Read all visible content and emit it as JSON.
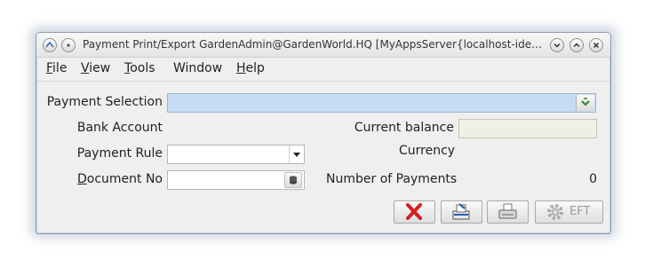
{
  "window": {
    "title": "Payment Print/Export  GardenAdmin@GardenWorld.HQ [MyAppsServer{localhost-idempiere-..."
  },
  "menu": [
    {
      "label": "File",
      "mnemonic": "F",
      "rest": "ile"
    },
    {
      "label": "View",
      "mnemonic": "V",
      "rest": "iew"
    },
    {
      "label": "Tools",
      "mnemonic": "T",
      "rest": "ools"
    },
    {
      "label": "Window",
      "mnemonic": "",
      "rest": "Window"
    },
    {
      "label": "Help",
      "mnemonic": "H",
      "rest": "elp"
    }
  ],
  "form": {
    "payment_selection_label": "Payment Selection",
    "payment_selection_value": "",
    "bank_account_label": "Bank Account",
    "bank_account_value": "",
    "current_balance_label": "Current balance",
    "current_balance_value": "",
    "payment_rule_label": "Payment Rule",
    "payment_rule_value": "",
    "currency_label": "Currency",
    "currency_value": "",
    "document_no_label_mnemonic": "D",
    "document_no_label_rest": "ocument No",
    "document_no_value": "",
    "number_of_payments_label": "Number of Payments",
    "number_of_payments_value": "0"
  },
  "buttons": {
    "eft_label": "EFT"
  },
  "colors": {
    "selection_field_bg": "#c6dcf4",
    "balance_field_bg": "#efefe6",
    "cancel_red": "#d42020"
  },
  "icons": [
    "app-icon",
    "shade-icon",
    "minimize-icon",
    "maximize-icon",
    "close-icon",
    "zoom-arrow-icon",
    "dropdown-arrow-icon",
    "database-icon",
    "cancel-icon",
    "export-icon",
    "print-icon",
    "gear-icon"
  ]
}
